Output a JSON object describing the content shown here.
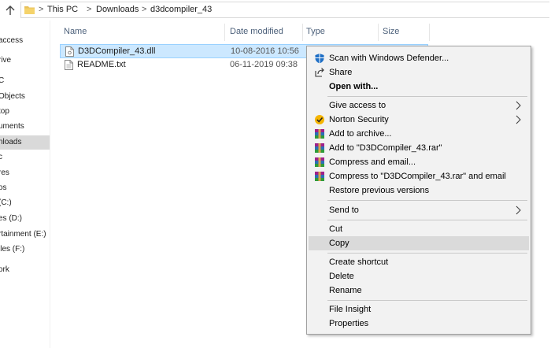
{
  "breadcrumb": {
    "items": [
      "This PC",
      "Downloads",
      "d3dcompiler_43"
    ],
    "separator": ">"
  },
  "nav": {
    "items": [
      {
        "label": "access"
      },
      {
        "label": "rive"
      },
      {
        "label": "C"
      },
      {
        "label": "Objects"
      },
      {
        "label": "top"
      },
      {
        "label": "uments"
      },
      {
        "label": "nloads",
        "selected": true
      },
      {
        "label": "c"
      },
      {
        "label": "res"
      },
      {
        "label": "os"
      },
      {
        "label": "(C:)"
      },
      {
        "label": "es (D:)"
      },
      {
        "label": "rtainment (E:)"
      },
      {
        "label": "iles (F:)"
      },
      {
        "label": "ork"
      }
    ]
  },
  "columns": {
    "name": "Name",
    "date": "Date modified",
    "type": "Type",
    "size": "Size"
  },
  "files": [
    {
      "name": "D3DCompiler_43.dll",
      "date": "10-08-2016 10:56",
      "icon": "dll-file-icon",
      "selected": true
    },
    {
      "name": "README.txt",
      "date": "06-11-2019 09:38",
      "icon": "text-file-icon",
      "selected": false
    }
  ],
  "context_menu": {
    "scan": "Scan with Windows Defender...",
    "share": "Share",
    "open_with": "Open with...",
    "give_access": "Give access to",
    "norton": "Norton Security",
    "add_archive": "Add to archive...",
    "add_rar": "Add to \"D3DCompiler_43.rar\"",
    "compress_email": "Compress and email...",
    "compress_rar_email": "Compress to \"D3DCompiler_43.rar\" and email",
    "restore": "Restore previous versions",
    "send_to": "Send to",
    "cut": "Cut",
    "copy": "Copy",
    "create_shortcut": "Create shortcut",
    "delete": "Delete",
    "rename": "Rename",
    "file_insight": "File Insight",
    "properties": "Properties"
  },
  "colors": {
    "selection": "#cce8ff",
    "menu_bg": "#f2f2f2",
    "menu_hot": "#dadada",
    "header_text": "#4c607a"
  }
}
